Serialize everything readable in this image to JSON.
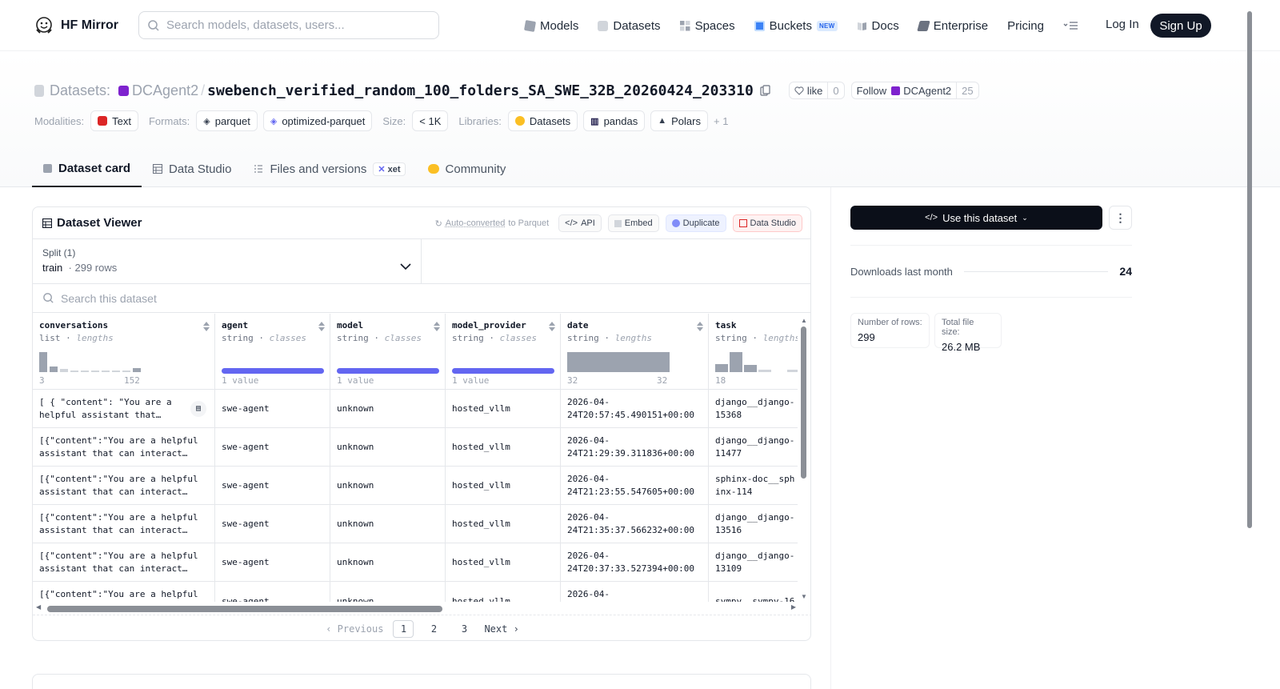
{
  "header": {
    "brand": "HF Mirror",
    "search_placeholder": "Search models, datasets, users...",
    "nav": [
      {
        "label": "Models",
        "icon": "cube-icon",
        "color": "#9ca3af"
      },
      {
        "label": "Datasets",
        "icon": "database-icon",
        "color": "#9ca3af"
      },
      {
        "label": "Spaces",
        "icon": "grid-icon",
        "color": "#9ca3af"
      },
      {
        "label": "Buckets",
        "icon": "bucket-icon",
        "color": "#3b82f6",
        "badge": "NEW"
      },
      {
        "label": "Docs",
        "icon": "book-icon",
        "color": "#9ca3af"
      },
      {
        "label": "Enterprise",
        "icon": "enterprise-icon",
        "color": "#6b7280"
      },
      {
        "label": "Pricing"
      }
    ],
    "login": "Log In",
    "signup": "Sign Up"
  },
  "dataset": {
    "section_label": "Datasets:",
    "owner": "DCAgent2",
    "name": "swebench_verified_random_100_folders_SA_SWE_32B_20260424_203310",
    "like_label": "like",
    "like_count": "0",
    "follow_label": "Follow",
    "follow_owner": "DCAgent2",
    "follow_count": "25"
  },
  "meta": {
    "modalities_label": "Modalities:",
    "modalities": [
      "Text"
    ],
    "formats_label": "Formats:",
    "formats": [
      "parquet",
      "optimized-parquet"
    ],
    "size_label": "Size:",
    "size": "< 1K",
    "libraries_label": "Libraries:",
    "libraries": [
      "Datasets",
      "pandas",
      "Polars"
    ],
    "more_libraries": "+ 1"
  },
  "tabs": [
    {
      "label": "Dataset card",
      "active": true
    },
    {
      "label": "Data Studio"
    },
    {
      "label": "Files and versions",
      "badge": "xet"
    },
    {
      "label": "Community"
    }
  ],
  "viewer": {
    "title": "Dataset Viewer",
    "auto_converted": "Auto-converted",
    "to_parquet": "to Parquet",
    "actions": [
      "API",
      "Embed",
      "Duplicate",
      "Data Studio"
    ],
    "split_label": "Split (1)",
    "split_name": "train",
    "split_rows": "299 rows",
    "search_placeholder": "Search this dataset",
    "columns": [
      {
        "name": "conversations",
        "type": "list",
        "stat": "lengths",
        "min": "3",
        "max": "152"
      },
      {
        "name": "agent",
        "type": "string",
        "stat": "classes",
        "summary": "1 value"
      },
      {
        "name": "model",
        "type": "string",
        "stat": "classes",
        "summary": "1 value"
      },
      {
        "name": "model_provider",
        "type": "string",
        "stat": "classes",
        "summary": "1 value"
      },
      {
        "name": "date",
        "type": "string",
        "stat": "lengths",
        "min": "32",
        "max": "32"
      },
      {
        "name": "task",
        "type": "string",
        "stat": "lengths",
        "min": "18"
      }
    ],
    "rows": [
      [
        "[ { \"content\": \"You are a helpful assistant that…",
        "swe-agent",
        "unknown",
        "hosted_vllm",
        "2026-04-24T20:57:45.490151+00:00",
        "django__django-15368"
      ],
      [
        "[{\"content\":\"You are a helpful assistant that can interact…",
        "swe-agent",
        "unknown",
        "hosted_vllm",
        "2026-04-24T21:29:39.311836+00:00",
        "django__django-11477"
      ],
      [
        "[{\"content\":\"You are a helpful assistant that can interact…",
        "swe-agent",
        "unknown",
        "hosted_vllm",
        "2026-04-24T21:23:55.547605+00:00",
        "sphinx-doc__sphinx-114"
      ],
      [
        "[{\"content\":\"You are a helpful assistant that can interact…",
        "swe-agent",
        "unknown",
        "hosted_vllm",
        "2026-04-24T21:35:37.566232+00:00",
        "django__django-13516"
      ],
      [
        "[{\"content\":\"You are a helpful assistant that can interact…",
        "swe-agent",
        "unknown",
        "hosted_vllm",
        "2026-04-24T20:37:33.527394+00:00",
        "django__django-13109"
      ],
      [
        "[{\"content\":\"You are a helpful",
        "swe-agent",
        "unknown",
        "hosted_vllm",
        "2026-04-",
        "sympy__sympy-16"
      ]
    ],
    "pager": {
      "prev": "Previous",
      "pages": [
        "1",
        "2",
        "3"
      ],
      "current": "1",
      "next": "Next"
    }
  },
  "sidebar": {
    "use_button": "Use this dataset",
    "downloads_label": "Downloads last month",
    "downloads_value": "24",
    "num_rows_label": "Number of rows:",
    "num_rows_value": "299",
    "file_size_label": "Total file size:",
    "file_size_value": "26.2 MB"
  },
  "colors": {
    "accent_bar": "#6366f1",
    "hist_bar": "#9ca3af",
    "primary_dark": "#111827"
  }
}
